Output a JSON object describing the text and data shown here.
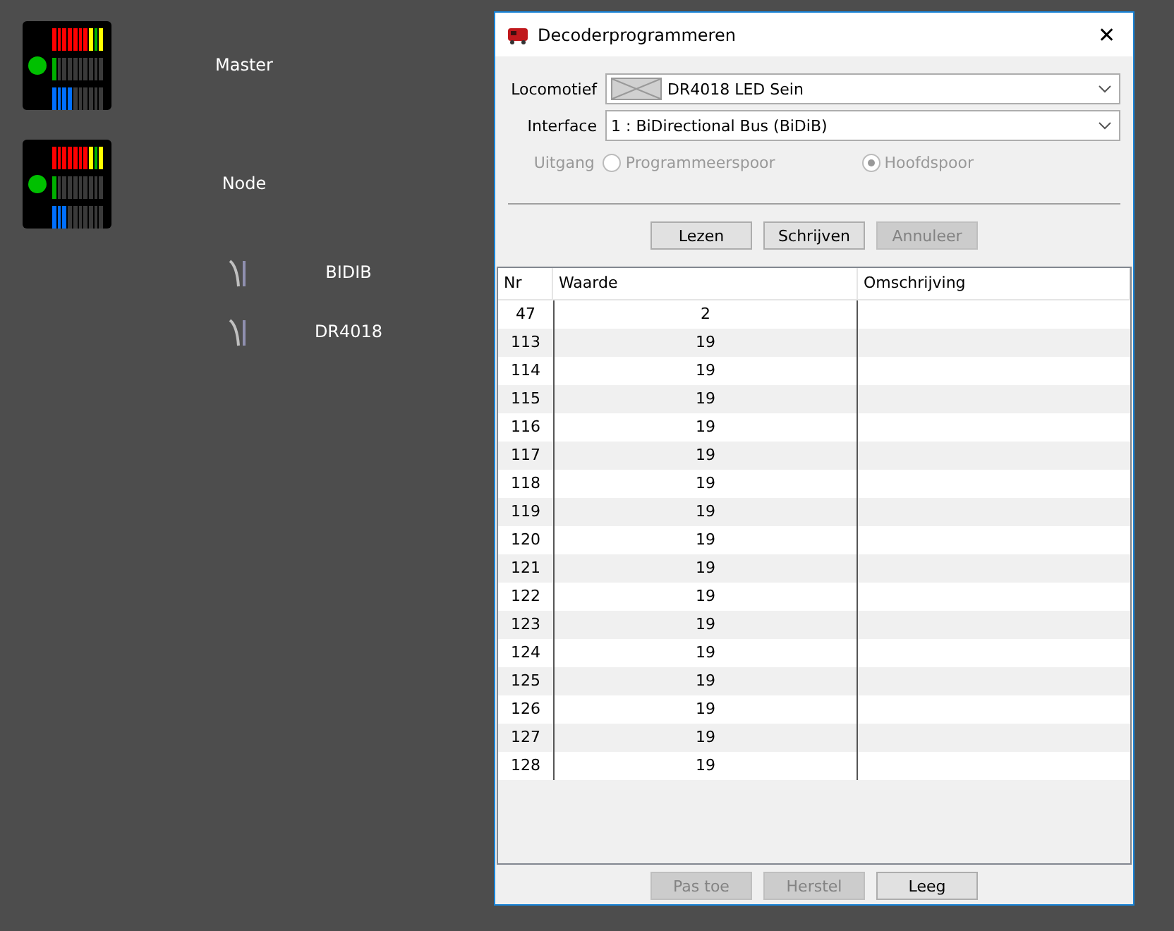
{
  "canvas": {
    "nodes": [
      {
        "label": "Master",
        "color": "#00c000",
        "meters": [
          {
            "kind": "signal",
            "level": 1
          },
          {
            "kind": "green",
            "level": 0.1
          },
          {
            "kind": "blue",
            "level": 0.4
          }
        ]
      },
      {
        "label": "Node",
        "color": "#00c000",
        "meters": [
          {
            "kind": "signal",
            "level": 1
          },
          {
            "kind": "green",
            "level": 0.1
          },
          {
            "kind": "blue",
            "level": 0.3
          }
        ]
      }
    ],
    "switches": [
      {
        "label": "BIDIB"
      },
      {
        "label": "DR4018"
      }
    ]
  },
  "window": {
    "title": "Decoderprogrammeren",
    "close": "✕"
  },
  "form": {
    "locomotief": {
      "label": "Locomotief",
      "value": "DR4018 LED Sein"
    },
    "interface": {
      "label": "Interface",
      "value": "1 : BiDirectional Bus (BiDiB)"
    },
    "uitgang": {
      "label": "Uitgang",
      "disabled": true,
      "options": [
        {
          "label": "Programmeerspoor",
          "selected": false
        },
        {
          "label": "Hoofdspoor",
          "selected": true
        }
      ]
    }
  },
  "actions": [
    {
      "label": "Lezen",
      "disabled": false
    },
    {
      "label": "Schrijven",
      "disabled": false
    },
    {
      "label": "Annuleer",
      "disabled": true
    }
  ],
  "table": {
    "columns": [
      "Nr",
      "Waarde",
      "Omschrijving"
    ],
    "rows": [
      [
        "47",
        "2",
        ""
      ],
      [
        "113",
        "19",
        ""
      ],
      [
        "114",
        "19",
        ""
      ],
      [
        "115",
        "19",
        ""
      ],
      [
        "116",
        "19",
        ""
      ],
      [
        "117",
        "19",
        ""
      ],
      [
        "118",
        "19",
        ""
      ],
      [
        "119",
        "19",
        ""
      ],
      [
        "120",
        "19",
        ""
      ],
      [
        "121",
        "19",
        ""
      ],
      [
        "122",
        "19",
        ""
      ],
      [
        "123",
        "19",
        ""
      ],
      [
        "124",
        "19",
        ""
      ],
      [
        "125",
        "19",
        ""
      ],
      [
        "126",
        "19",
        ""
      ],
      [
        "127",
        "19",
        ""
      ],
      [
        "128",
        "19",
        ""
      ]
    ]
  },
  "footer_buttons": [
    {
      "label": "Pas toe",
      "disabled": true
    },
    {
      "label": "Herstel",
      "disabled": true
    },
    {
      "label": "Leeg",
      "disabled": false
    }
  ]
}
